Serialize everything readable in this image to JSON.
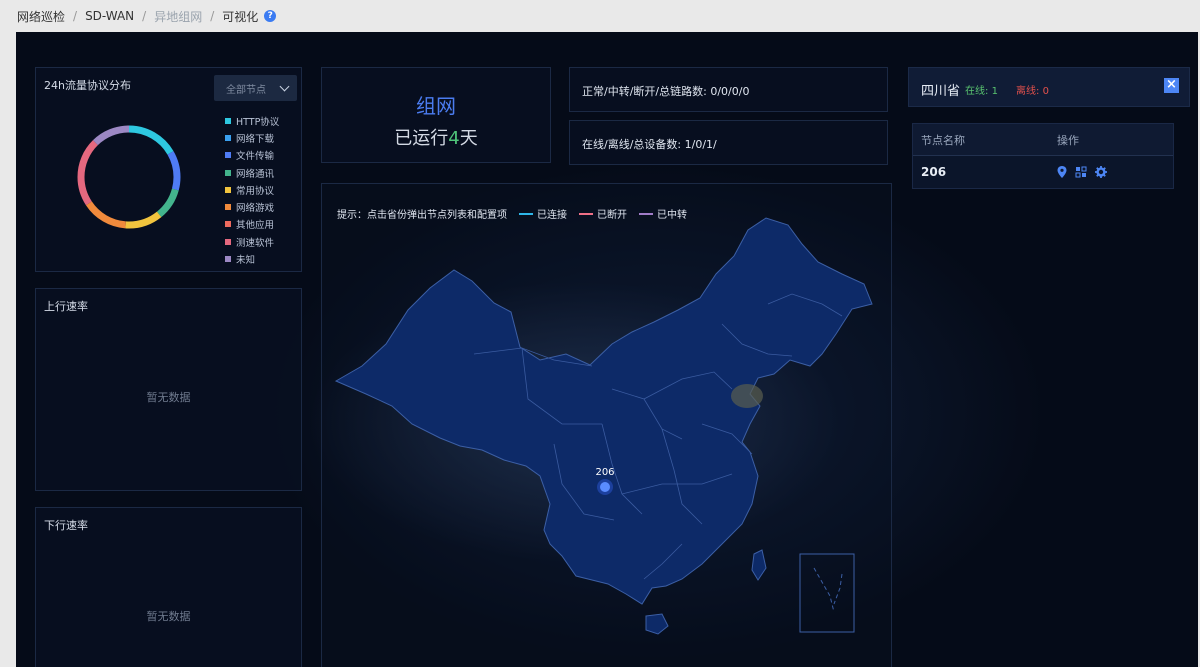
{
  "breadcrumb": {
    "items": [
      "网络巡检",
      "SD-WAN",
      "异地组网",
      "可视化"
    ],
    "help_icon": "question-circle-icon"
  },
  "traffic_panel": {
    "title": "24h流量协议分布",
    "node_select": "全部节点",
    "legend": [
      {
        "label": "HTTP协议",
        "color": "#2ec8e0"
      },
      {
        "label": "网络下载",
        "color": "#3aa0f0"
      },
      {
        "label": "文件传输",
        "color": "#4f7cf5"
      },
      {
        "label": "网络通讯",
        "color": "#43b48d"
      },
      {
        "label": "常用协议",
        "color": "#f1c43e"
      },
      {
        "label": "网络游戏",
        "color": "#f08a3c"
      },
      {
        "label": "其他应用",
        "color": "#ee6a5e"
      },
      {
        "label": "测速软件",
        "color": "#e4687f"
      },
      {
        "label": "未知",
        "color": "#9c88c4"
      }
    ]
  },
  "upload_panel": {
    "title": "上行速率",
    "empty": "暂无数据"
  },
  "download_panel": {
    "title": "下行速率",
    "empty": "暂无数据"
  },
  "network_card": {
    "title": "组网",
    "run_prefix": "已运行",
    "days": "4",
    "run_suffix": "天"
  },
  "links_stat": {
    "label": "正常/中转/断开/总链路数:",
    "value": "0/0/0/0"
  },
  "devices_stat": {
    "label": "在线/离线/总设备数:",
    "value": "1/0/1/"
  },
  "map": {
    "hint": "提示：点击省份弹出节点列表和配置项",
    "legend": [
      {
        "label": "已连接",
        "color": "#2eb6e8"
      },
      {
        "label": "已断开",
        "color": "#ef6f86"
      },
      {
        "label": "已中转",
        "color": "#a07cc8"
      }
    ],
    "node_label": "206"
  },
  "province": {
    "name": "四川省",
    "online_label": "在线:",
    "online": "1",
    "offline_label": "离线:",
    "offline": "0"
  },
  "node_table": {
    "col_name": "节点名称",
    "col_action": "操作",
    "rows": [
      {
        "name": "206"
      }
    ]
  }
}
